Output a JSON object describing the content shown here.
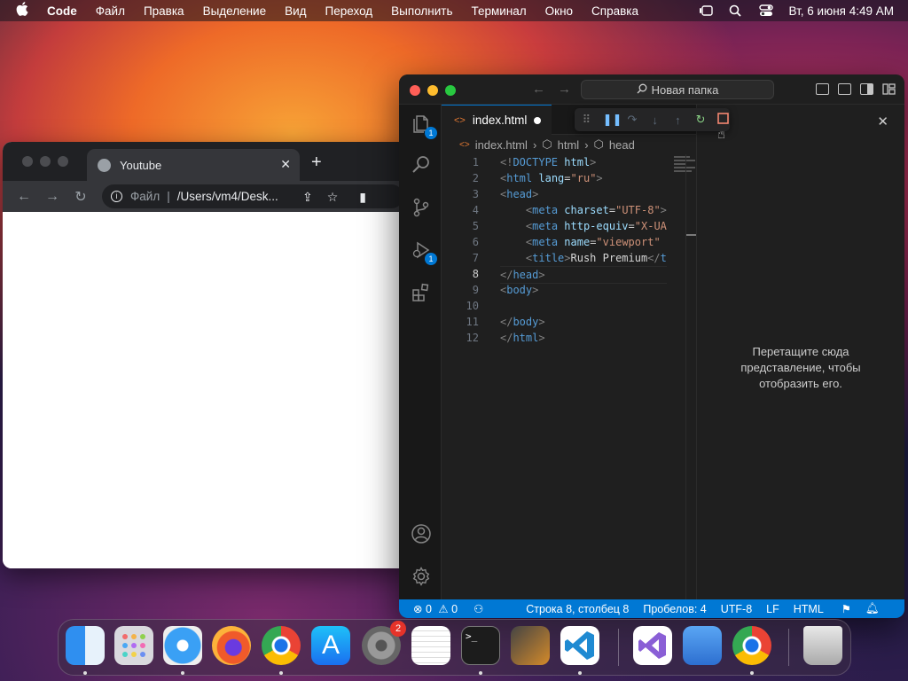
{
  "menubar": {
    "app_name": "Code",
    "items": [
      "Файл",
      "Правка",
      "Выделение",
      "Вид",
      "Переход",
      "Выполнить",
      "Терминал",
      "Окно",
      "Справка"
    ],
    "datetime": "Вт, 6 июня  4:49 AM"
  },
  "chrome": {
    "tab_title": "Youtube",
    "tab_close": "✕",
    "new_tab": "+",
    "omnibox_scheme": "Файл",
    "omnibox_path": "/Users/vm4/Desk..."
  },
  "vscode": {
    "search_label": "Новая папка",
    "tab_name": "index.html",
    "breadcrumb": [
      "index.html",
      "html",
      "head"
    ],
    "activity_badges": {
      "explorer": "1",
      "debug": "1"
    },
    "code_lines": [
      {
        "n": "1",
        "html": "<span class='t-br'>&lt;!</span><span class='t-tag'>DOCTYPE</span> <span class='t-attr'>html</span><span class='t-br'>&gt;</span>"
      },
      {
        "n": "2",
        "html": "<span class='t-br'>&lt;</span><span class='t-tag'>html</span> <span class='t-attr'>lang</span>=<span class='t-str'>\"ru\"</span><span class='t-br'>&gt;</span>"
      },
      {
        "n": "3",
        "html": "<span class='t-br'>&lt;</span><span class='t-tag'>head</span><span class='t-br'>&gt;</span>"
      },
      {
        "n": "4",
        "html": "&nbsp;&nbsp;&nbsp;&nbsp;<span class='t-br'>&lt;</span><span class='t-tag'>meta</span> <span class='t-attr'>charset</span>=<span class='t-str'>\"UTF-8\"</span><span class='t-br'>&gt;</span>"
      },
      {
        "n": "5",
        "html": "&nbsp;&nbsp;&nbsp;&nbsp;<span class='t-br'>&lt;</span><span class='t-tag'>meta</span> <span class='t-attr'>http-equiv</span>=<span class='t-str'>\"X-UA</span>"
      },
      {
        "n": "6",
        "html": "&nbsp;&nbsp;&nbsp;&nbsp;<span class='t-br'>&lt;</span><span class='t-tag'>meta</span> <span class='t-attr'>name</span>=<span class='t-str'>\"viewport\"</span>"
      },
      {
        "n": "7",
        "html": "&nbsp;&nbsp;&nbsp;&nbsp;<span class='t-br'>&lt;</span><span class='t-tag'>title</span><span class='t-br'>&gt;</span><span class='t-text'>Rush Premium</span><span class='t-br'>&lt;/</span><span class='t-tag'>t</span>"
      },
      {
        "n": "8",
        "html": "<span class='t-br'>&lt;/</span><span class='t-tag'>head</span><span class='t-br'>&gt;</span>"
      },
      {
        "n": "9",
        "html": "<span class='t-br'>&lt;</span><span class='t-tag'>body</span><span class='t-br'>&gt;</span>"
      },
      {
        "n": "10",
        "html": ""
      },
      {
        "n": "11",
        "html": "<span class='t-br'>&lt;/</span><span class='t-tag'>body</span><span class='t-br'>&gt;</span>"
      },
      {
        "n": "12",
        "html": "<span class='t-br'>&lt;/</span><span class='t-tag'>html</span><span class='t-br'>&gt;</span>"
      }
    ],
    "panel_message": "Перетащите сюда представление, чтобы отобразить его.",
    "status": {
      "errors": "0",
      "warnings": "0",
      "position": "Строка 8, столбец 8",
      "spaces": "Пробелов: 4",
      "encoding": "UTF-8",
      "eol": "LF",
      "language": "HTML"
    }
  },
  "dock": {
    "settings_badge": "2"
  },
  "colors": {
    "accent": "#0078d4",
    "stop_button": "#f48771",
    "restart_button": "#89d185",
    "debug_controls": "#75beff"
  }
}
